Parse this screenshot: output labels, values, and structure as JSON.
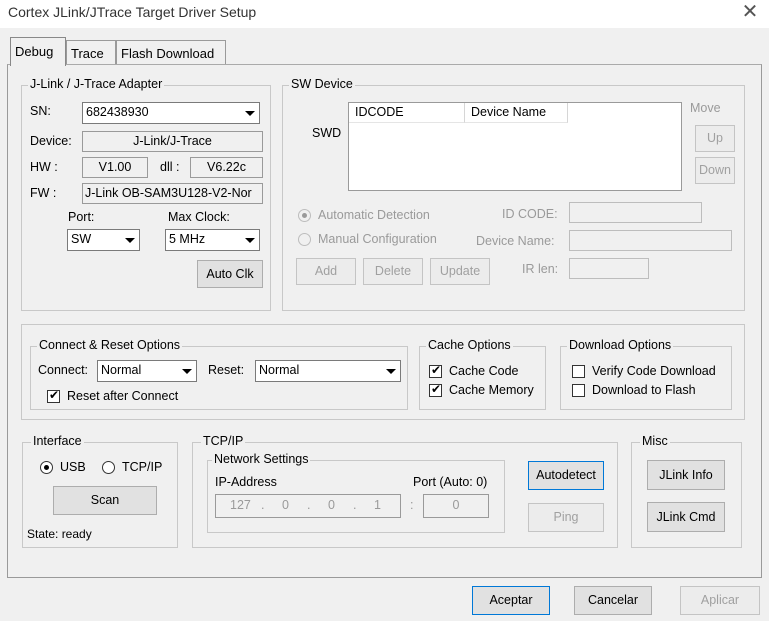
{
  "window": {
    "title": "Cortex JLink/JTrace Target Driver Setup"
  },
  "tabs": [
    "Debug",
    "Trace",
    "Flash Download"
  ],
  "adapter": {
    "title": "J-Link / J-Trace Adapter",
    "sn_label": "SN:",
    "sn_value": "682438930",
    "device_label": "Device:",
    "device_value": "J-Link/J-Trace",
    "hw_label": "HW :",
    "hw_value": "V1.00",
    "dll_label": "dll :",
    "dll_value": "V6.22c",
    "fw_label": "FW :",
    "fw_value": "J-Link OB-SAM3U128-V2-Nor",
    "port_label": "Port:",
    "port_value": "SW",
    "maxclock_label": "Max Clock:",
    "maxclock_value": "5 MHz",
    "autoclk": "Auto Clk"
  },
  "swdevice": {
    "title": "SW Device",
    "swd_label": "SWD",
    "col_idcode": "IDCODE",
    "col_devname": "Device Name",
    "move_label": "Move",
    "up": "Up",
    "down": "Down",
    "auto_detect": "Automatic Detection",
    "manual_config": "Manual Configuration",
    "idcode_label": "ID CODE:",
    "devname_label": "Device Name:",
    "irlen_label": "IR len:",
    "add": "Add",
    "delete": "Delete",
    "update": "Update"
  },
  "connect_reset": {
    "title": "Connect & Reset Options",
    "connect_label": "Connect:",
    "connect_value": "Normal",
    "reset_label": "Reset:",
    "reset_value": "Normal",
    "reset_after_connect": "Reset after Connect"
  },
  "cache": {
    "title": "Cache Options",
    "cache_code": "Cache Code",
    "cache_memory": "Cache Memory"
  },
  "download": {
    "title": "Download Options",
    "verify": "Verify Code Download",
    "to_flash": "Download to Flash"
  },
  "interface": {
    "title": "Interface",
    "usb": "USB",
    "tcpip": "TCP/IP",
    "scan": "Scan",
    "state": "State: ready"
  },
  "tcpip": {
    "title": "TCP/IP",
    "net_settings": "Network Settings",
    "ip_label": "IP-Address",
    "port_label": "Port (Auto: 0)",
    "ip1": "127",
    "ip2": "0",
    "ip3": "0",
    "ip4": "1",
    "dot": ".",
    "colon": ":",
    "port_value": "0",
    "autodetect": "Autodetect",
    "ping": "Ping"
  },
  "misc": {
    "title": "Misc",
    "jlink_info": "JLink Info",
    "jlink_cmd": "JLink Cmd"
  },
  "footer": {
    "accept": "Aceptar",
    "cancel": "Cancelar",
    "apply": "Aplicar"
  }
}
